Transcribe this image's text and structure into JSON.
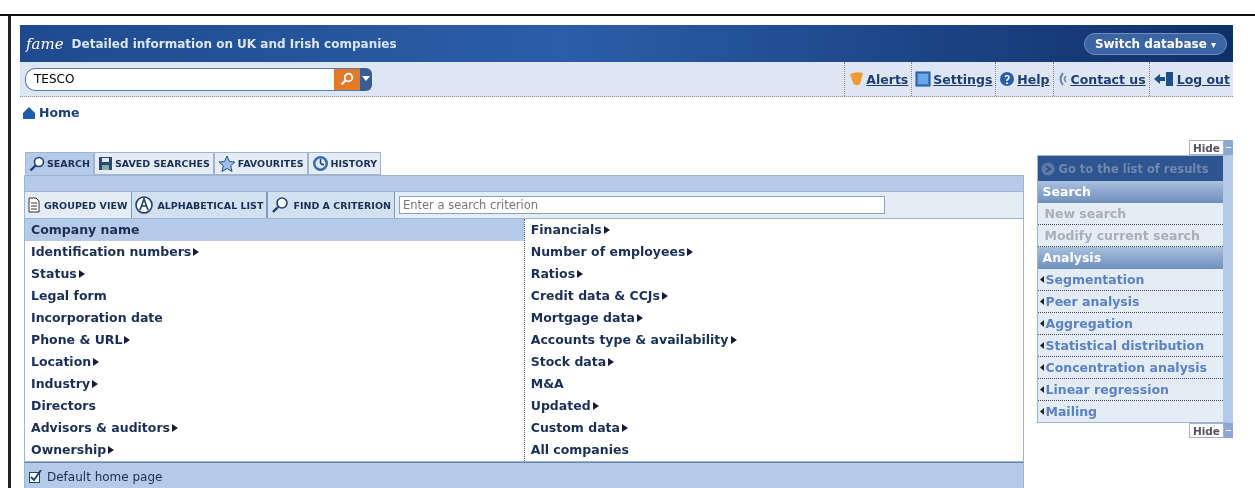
{
  "header": {
    "logo": "fame",
    "tagline": "Detailed information on UK and Irish companies",
    "switch_button": "Switch database",
    "switch_caret": "▾"
  },
  "search": {
    "value": "TESCO"
  },
  "links": [
    {
      "kind": "alerts",
      "label": "Alerts"
    },
    {
      "kind": "settings",
      "label": "Settings"
    },
    {
      "kind": "help",
      "label": "Help"
    },
    {
      "kind": "contact",
      "label": "Contact us"
    },
    {
      "kind": "logout",
      "label": "Log out"
    }
  ],
  "breadcrumb": "Home",
  "tabs": [
    {
      "kind": "search",
      "label": "SEARCH",
      "selected": true
    },
    {
      "kind": "saved",
      "label": "SAVED SEARCHES",
      "selected": false
    },
    {
      "kind": "favourites",
      "label": "FAVOURITES",
      "selected": false
    },
    {
      "kind": "history",
      "label": "HISTORY",
      "selected": false
    }
  ],
  "subtabs": [
    {
      "kind": "grouped",
      "label": "GROUPED VIEW",
      "selected": true
    },
    {
      "kind": "alpha",
      "label": "ALPHABETICAL LIST",
      "selected": false
    },
    {
      "kind": "find",
      "label": "FIND A CRITERION",
      "selected": false
    }
  ],
  "criterion_field": {
    "placeholder": "Enter a search criterion"
  },
  "criteria_left": [
    {
      "label": "Company name",
      "submenu": false,
      "selected": true
    },
    {
      "label": "Identification numbers",
      "submenu": true,
      "selected": false
    },
    {
      "label": "Status",
      "submenu": true,
      "selected": false
    },
    {
      "label": "Legal form",
      "submenu": false,
      "selected": false
    },
    {
      "label": "Incorporation date",
      "submenu": false,
      "selected": false
    },
    {
      "label": "Phone & URL",
      "submenu": true,
      "selected": false
    },
    {
      "label": "Location",
      "submenu": true,
      "selected": false
    },
    {
      "label": "Industry",
      "submenu": true,
      "selected": false
    },
    {
      "label": "Directors",
      "submenu": false,
      "selected": false
    },
    {
      "label": "Advisors & auditors",
      "submenu": true,
      "selected": false
    },
    {
      "label": "Ownership",
      "submenu": true,
      "selected": false
    }
  ],
  "criteria_right": [
    {
      "label": "Financials",
      "submenu": true,
      "selected": false
    },
    {
      "label": "Number of employees",
      "submenu": true,
      "selected": false
    },
    {
      "label": "Ratios",
      "submenu": true,
      "selected": false
    },
    {
      "label": "Credit data & CCJs",
      "submenu": true,
      "selected": false
    },
    {
      "label": "Mortgage data",
      "submenu": true,
      "selected": false
    },
    {
      "label": "Accounts type & availability",
      "submenu": true,
      "selected": false
    },
    {
      "label": "Stock data",
      "submenu": true,
      "selected": false
    },
    {
      "label": "M&A",
      "submenu": false,
      "selected": false
    },
    {
      "label": "Updated",
      "submenu": true,
      "selected": false
    },
    {
      "label": "Custom data",
      "submenu": true,
      "selected": false
    },
    {
      "label": "All companies",
      "submenu": false,
      "selected": false
    }
  ],
  "default_home": {
    "label": "Default home page",
    "checked": true
  },
  "side_panel": {
    "hide_top": "Hide",
    "hide_bottom": "Hide",
    "results_link": {
      "label": "Go to the list of results",
      "disabled": true
    },
    "sections": [
      {
        "title": "Search",
        "items": [
          {
            "label": "New search",
            "disabled": true,
            "arrow": false
          },
          {
            "label": "Modify current search",
            "disabled": true,
            "arrow": false
          }
        ]
      },
      {
        "title": "Analysis",
        "items": [
          {
            "label": "Segmentation",
            "disabled": false,
            "arrow": true
          },
          {
            "label": "Peer analysis",
            "disabled": false,
            "arrow": true
          },
          {
            "label": "Aggregation",
            "disabled": false,
            "arrow": true
          },
          {
            "label": "Statistical distribution",
            "disabled": false,
            "arrow": true
          },
          {
            "label": "Concentration analysis",
            "disabled": false,
            "arrow": true
          },
          {
            "label": "Linear regression",
            "disabled": false,
            "arrow": true
          },
          {
            "label": "Mailing",
            "disabled": false,
            "arrow": true
          }
        ]
      }
    ]
  }
}
